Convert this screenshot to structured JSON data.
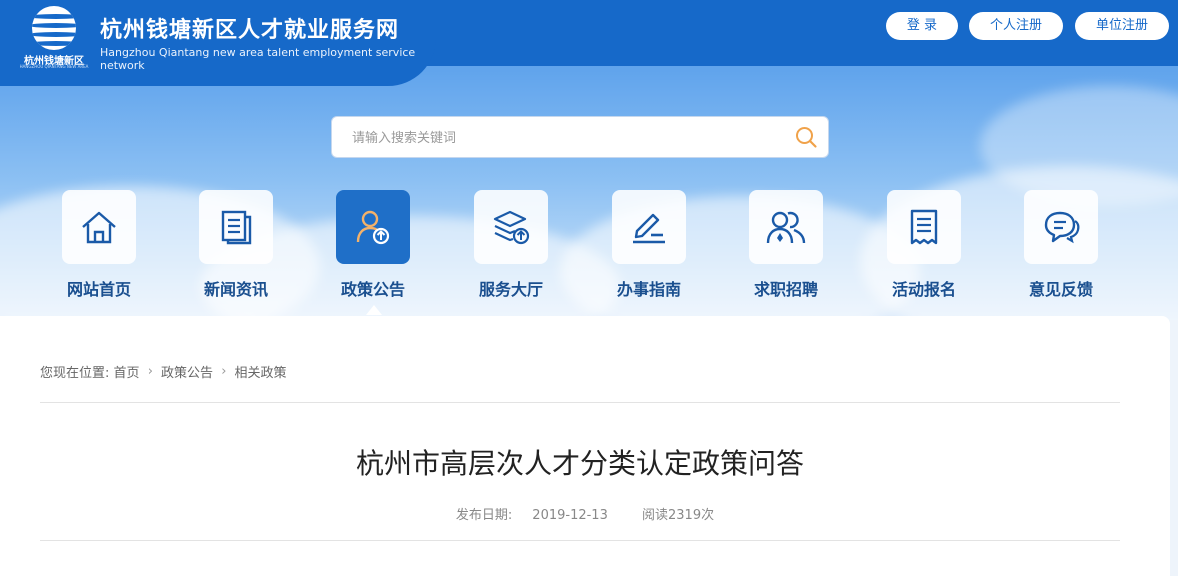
{
  "header": {
    "logo_text": "杭州钱塘新区",
    "logo_subtext": "HANGZHOU QIANTANG NEW AREA",
    "title": "杭州钱塘新区人才就业服务网",
    "subtitle": "Hangzhou Qiantang new area talent employment service network",
    "buttons": {
      "login": "登 录",
      "personal_register": "个人注册",
      "company_register": "单位注册"
    }
  },
  "search": {
    "placeholder": "请输入搜索关键词"
  },
  "nav": {
    "items": [
      {
        "label": "网站首页",
        "icon": "home-icon"
      },
      {
        "label": "新闻资讯",
        "icon": "news-icon"
      },
      {
        "label": "政策公告",
        "icon": "policy-icon",
        "active": true
      },
      {
        "label": "服务大厅",
        "icon": "layers-upload-icon"
      },
      {
        "label": "办事指南",
        "icon": "pen-icon"
      },
      {
        "label": "求职招聘",
        "icon": "users-icon"
      },
      {
        "label": "活动报名",
        "icon": "document-icon"
      },
      {
        "label": "意见反馈",
        "icon": "chat-icon"
      }
    ]
  },
  "breadcrumb": {
    "prefix": "您现在位置:",
    "items": [
      "首页",
      "政策公告",
      "相关政策"
    ]
  },
  "article": {
    "title": "杭州市高层次人才分类认定政策问答",
    "publish_label": "发布日期:",
    "publish_date": "2019-12-13",
    "reads": "阅读2319次"
  },
  "colors": {
    "primary": "#1669c9",
    "active_tile": "#1f6fc8",
    "nav_label": "#1a4f8f"
  }
}
